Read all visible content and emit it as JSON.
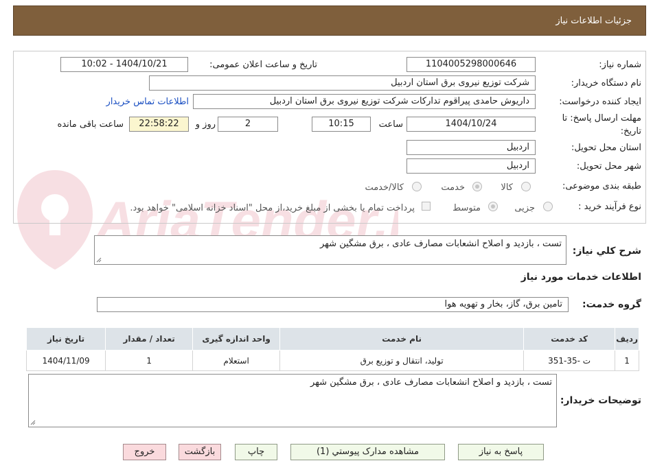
{
  "header": {
    "title": "جزئیات اطلاعات نیاز"
  },
  "labels": {
    "need_number": "شماره نیاز:",
    "announce_datetime": "تاریخ و ساعت اعلان عمومی:",
    "buyer_org": "نام دستگاه خریدار:",
    "requester": "ایجاد کننده درخواست:",
    "deadline_1": "مهلت ارسال پاسخ: تا",
    "deadline_2": "تاریخ:",
    "time": "ساعت",
    "days_and": "روز و",
    "remaining": "ساعت باقی مانده",
    "province": "استان محل تحویل:",
    "city": "شهر محل تحویل:",
    "category": "طبقه بندی موضوعی:",
    "process": "نوع فرآیند خرید :",
    "general_desc": "شرح کلي نياز:",
    "services_section": "اطلاعات خدمات مورد نیاز",
    "service_group": "گروه خدمت:",
    "buyer_notes": "توضیحات خریدار:"
  },
  "values": {
    "need_number": "1104005298000646",
    "announce_datetime": "1404/10/21 - 10:02",
    "buyer_org": "شرکت توزیع نیروی برق استان اردبیل",
    "requester": "داریوش حامدی پیراقوم تدارکات شرکت توزیع نیروی برق استان اردبیل",
    "contact_link": "اطلاعات تماس خریدار",
    "deadline_date": "1404/10/24",
    "deadline_time": "10:15",
    "days": "2",
    "remaining_time": "22:58:22",
    "province": "اردبیل",
    "city": "اردبیل",
    "general_desc": "تست ، بازدید و اصلاح انشعابات مصارف عادی ، برق مشگین شهر",
    "service_group": "تامین برق، گاز، بخار و تهویه هوا",
    "buyer_notes": "تست ، بازدید و اصلاح انشعابات مصارف عادی ، برق مشگین شهر"
  },
  "category_options": [
    {
      "label": "کالا",
      "selected": false
    },
    {
      "label": "خدمت",
      "selected": true
    },
    {
      "label": "کالا/خدمت",
      "selected": false
    }
  ],
  "process_options": [
    {
      "label": "جزیی",
      "selected": false
    },
    {
      "label": "متوسط",
      "selected": true
    }
  ],
  "payment_note": "پرداخت تمام یا بخشی از مبلغ خرید،از محل \"اسناد خزانه اسلامی\" خواهد بود.",
  "table": {
    "headers": [
      "ردیف",
      "کد خدمت",
      "نام خدمت",
      "واحد اندازه گیری",
      "تعداد / مقدار",
      "تاریخ نیاز"
    ],
    "rows": [
      [
        "1",
        "ت -35-351",
        "تولید، انتقال و توزیع برق",
        "استعلام",
        "1",
        "1404/11/09"
      ]
    ]
  },
  "buttons": {
    "reply": "پاسخ به نیاز",
    "attachments": "مشاهده مدارک پیوستي (1)",
    "print": "چاپ",
    "back": "بازگشت",
    "exit": "خروج"
  },
  "watermark_text": "AriaTender.neT",
  "colors": {
    "header": "#7f5f3c",
    "button_green": "#f1f9e8",
    "button_pink": "#fadadd",
    "link": "#1a4fc2",
    "table_header": "#dde3e8"
  }
}
